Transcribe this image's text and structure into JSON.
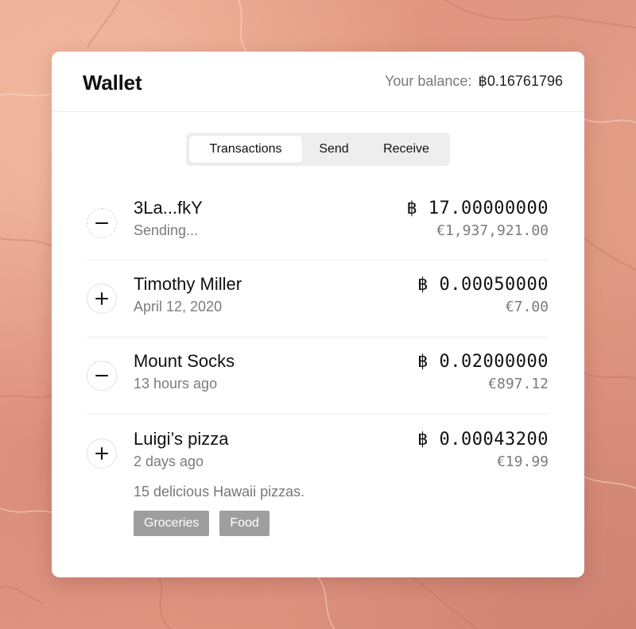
{
  "wallet": {
    "title": "Wallet",
    "balance_label": "Your balance:",
    "balance_value": "฿0.16761796"
  },
  "tabs": [
    {
      "label": "Transactions",
      "active": true
    },
    {
      "label": "Send",
      "active": false
    },
    {
      "label": "Receive",
      "active": false
    }
  ],
  "transactions": [
    {
      "direction": "minus",
      "icon": "minus-icon",
      "name": "3La...fkY",
      "subtitle": "Sending...",
      "amount": "฿ 17.00000000",
      "fiat": "€1,937,921.00"
    },
    {
      "direction": "plus",
      "icon": "plus-icon",
      "name": "Timothy Miller",
      "subtitle": "April 12, 2020",
      "amount": "฿ 0.00050000",
      "fiat": "€7.00"
    },
    {
      "direction": "minus",
      "icon": "minus-icon",
      "name": "Mount Socks",
      "subtitle": "13 hours ago",
      "amount": "฿ 0.02000000",
      "fiat": "€897.12"
    },
    {
      "direction": "plus",
      "icon": "plus-icon",
      "name": "Luigi’s pizza",
      "subtitle": "2 days ago",
      "amount": "฿ 0.00043200",
      "fiat": "€19.99",
      "description": "15 delicious Hawaii pizzas.",
      "tags": [
        "Groceries",
        "Food"
      ]
    }
  ],
  "colors": {
    "background": "#e3a08a",
    "card": "#ffffff",
    "tag": "#9e9e9e",
    "muted_text": "#7b7b7b"
  }
}
